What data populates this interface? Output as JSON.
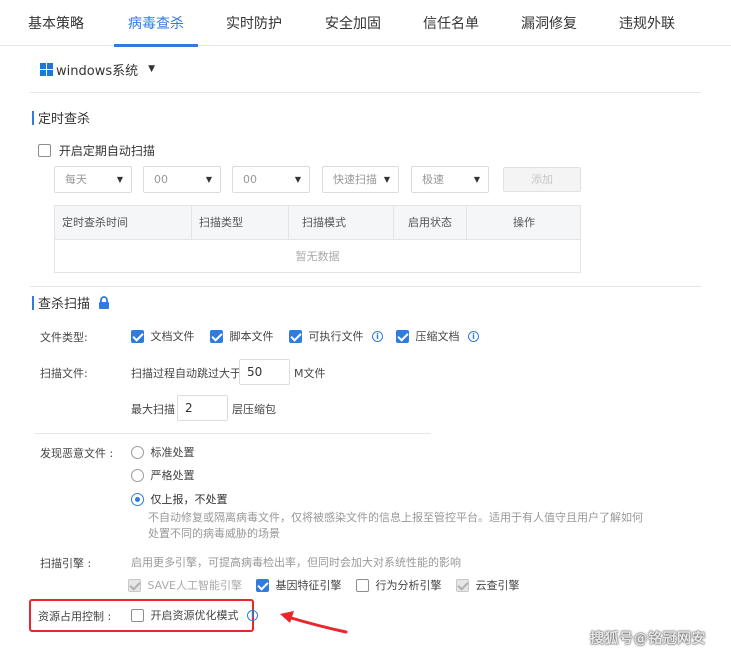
{
  "tabs": [
    {
      "label": "基本策略",
      "active": false
    },
    {
      "label": "病毒查杀",
      "active": true
    },
    {
      "label": "实时防护",
      "active": false
    },
    {
      "label": "安全加固",
      "active": false
    },
    {
      "label": "信任名单",
      "active": false
    },
    {
      "label": "漏洞修复",
      "active": false
    },
    {
      "label": "违规外联",
      "active": false
    }
  ],
  "os_selector": {
    "label": "windows系统",
    "icon": "windows-logo-icon"
  },
  "scheduled_scan": {
    "title": "定时查杀",
    "enable_label": "开启定期自动扫描",
    "enabled": false,
    "frequency": "每天",
    "hour": "00",
    "minute": "00",
    "scan_type": "快速扫描",
    "scan_speed": "极速",
    "add_button": "添加",
    "table": {
      "columns": [
        "定时查杀时间",
        "扫描类型",
        "扫描模式",
        "启用状态",
        "操作"
      ],
      "empty_text": "暂无数据"
    }
  },
  "scan": {
    "title": "查杀扫描",
    "lock_icon": "lock-icon",
    "file_types": {
      "label": "文件类型:",
      "options": [
        {
          "label": "文档文件",
          "checked": true,
          "info": false
        },
        {
          "label": "脚本文件",
          "checked": true,
          "info": false
        },
        {
          "label": "可执行文件",
          "checked": true,
          "info": true
        },
        {
          "label": "压缩文档",
          "checked": true,
          "info": true
        }
      ]
    },
    "scan_files": {
      "label": "扫描文件:",
      "skip_prefix": "扫描过程自动跳过大于",
      "skip_value": "50",
      "skip_unit": "M文件",
      "max_prefix": "最大扫描",
      "max_value": "2",
      "max_unit": "层压缩包"
    },
    "malicious": {
      "label": "发现恶意文件 :",
      "options": [
        {
          "label": "标准处置",
          "checked": false
        },
        {
          "label": "严格处置",
          "checked": false
        },
        {
          "label": "仅上报，不处置",
          "checked": true
        }
      ],
      "hint_line1": "不自动修复或隔离病毒文件，仅将被感染文件的信息上报至管控平台。适用于有人值守且用户了解如何",
      "hint_line2": "处置不同的病毒威胁的场景"
    },
    "engine": {
      "label": "扫描引擎 :",
      "hint": "启用更多引擎，可提高病毒检出率，但同时会加大对系统性能的影响",
      "options": [
        {
          "label": "SAVE人工智能引擎",
          "state": "disabled-checked"
        },
        {
          "label": "基因特征引擎",
          "state": "checked"
        },
        {
          "label": "行为分析引擎",
          "state": "unchecked"
        },
        {
          "label": "云查引擎",
          "state": "disabled-checked"
        }
      ]
    },
    "resource": {
      "label": "资源占用控制 :",
      "option": "开启资源优化模式",
      "checked": false
    }
  },
  "watermark": "搜狐号@铭冠网安",
  "colors": {
    "accent": "#2f7be0",
    "highlight": "#e8262b"
  }
}
